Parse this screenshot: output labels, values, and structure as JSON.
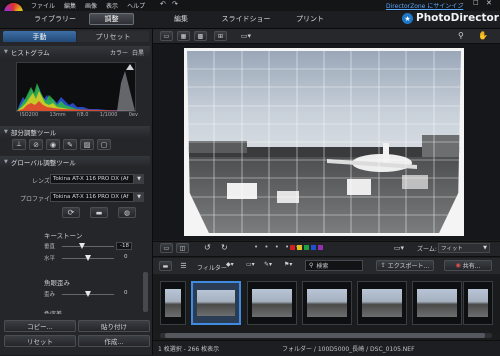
{
  "menu": {
    "items": [
      "ファイル",
      "編集",
      "画像",
      "表示",
      "ヘルプ"
    ],
    "signin_label": "DirectorZone にサインイン"
  },
  "brand": {
    "name": "PhotoDirector"
  },
  "modes": {
    "library": "ライブラリー",
    "adjust": "調整",
    "edit": "編集",
    "slideshow": "スライドショー",
    "print": "プリント"
  },
  "left_panel": {
    "tabs": {
      "manual": "手動",
      "preset": "プリセット"
    },
    "histogram": {
      "title": "ヒストグラム",
      "color_label": "カラー",
      "white_label": "白黒",
      "iso": "ISO200",
      "focal": "13mm",
      "aperture": "f/8.0",
      "shutter": "1/1000",
      "ev": "0ev"
    },
    "partial_tools": {
      "title": "部分調整ツール"
    },
    "global_tools": {
      "title": "グローバル調整ツール",
      "lens_label": "レンズ",
      "lens_value": "Tokina AT-X 116 PRO DX (Af",
      "profile_label": "プロファイル",
      "profile_value": "Tokina AT-X 116 PRO DX (Af",
      "keystone": {
        "title": "キーストーン",
        "vertical_label": "垂直",
        "vertical_value": "-18",
        "horizontal_label": "水平",
        "horizontal_value": "0"
      },
      "barrel": {
        "title": "魚眼歪み",
        "distortion_label": "歪み",
        "distortion_value": "0"
      },
      "partial_cutoff_label": "色収差"
    },
    "copy_label": "コピー...",
    "paste_label": "貼り付け",
    "reset_label": "リセット",
    "create_label": "作成..."
  },
  "bottom_toolbar": {
    "zoom_label": "ズーム:",
    "zoom_value": "フィット"
  },
  "filmstrip_toolbar": {
    "filter_label": "フィルター",
    "search_placeholder": "検索",
    "export_label": "エクスポート...",
    "share_label": "共有..."
  },
  "status": {
    "selection": "1 枚選択 - 266 枚表示",
    "path": "フォルダー / 100D5000_長崎 / DSC_0105.NEF"
  },
  "colors": {
    "accent": "#1e78c8",
    "label_red": "#d02020",
    "label_yellow": "#e0c020",
    "label_green": "#20a040",
    "label_blue": "#2050d0",
    "label_purple": "#9030b0"
  }
}
